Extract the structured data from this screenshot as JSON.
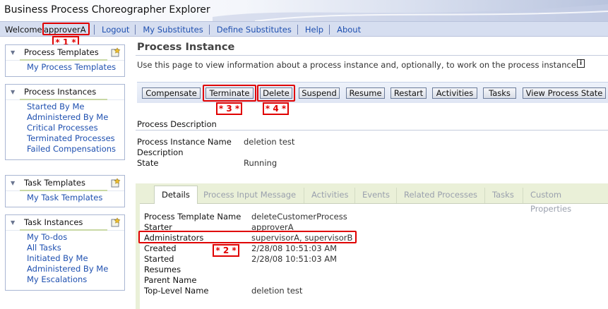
{
  "app": {
    "title": "Business Process Choreographer Explorer"
  },
  "nav": {
    "welcome": "Welcome",
    "user": "approverA",
    "links": [
      "Logout",
      "My Substitutes",
      "Define Substitutes",
      "Help",
      "About"
    ]
  },
  "sidebar": {
    "process_templates": {
      "title": "Process Templates",
      "items": [
        "My Process Templates"
      ]
    },
    "process_instances": {
      "title": "Process Instances",
      "items": [
        "Started By Me",
        "Administered By Me",
        "Critical Processes",
        "Terminated Processes",
        "Failed Compensations"
      ]
    },
    "task_templates": {
      "title": "Task Templates",
      "items": [
        "My Task Templates"
      ]
    },
    "task_instances": {
      "title": "Task Instances",
      "items": [
        "My To-dos",
        "All Tasks",
        "Initiated By Me",
        "Administered By Me",
        "My Escalations"
      ]
    }
  },
  "main": {
    "title": "Process Instance",
    "description": "Use this page to view information about a process instance and, optionally, to work on the process instance.",
    "info_icon": "i",
    "buttons": [
      "Compensate",
      "Terminate",
      "Delete",
      "Suspend",
      "Resume",
      "Restart",
      "Activities",
      "Tasks",
      "View Process State"
    ],
    "section": "Process Description",
    "fields": [
      {
        "label": "Process Instance Name",
        "value": "deletion test"
      },
      {
        "label": "Description",
        "value": ""
      },
      {
        "label": "State",
        "value": "Running"
      }
    ],
    "tabs": [
      "Details",
      "Process Input Message",
      "Activities",
      "Events",
      "Related Processes",
      "Tasks",
      "Custom Properties"
    ],
    "details": [
      {
        "label": "Process Template Name",
        "value": "deleteCustomerProcess"
      },
      {
        "label": "Starter",
        "value": "approverA"
      },
      {
        "label": "Administrators",
        "value": "supervisorA, supervisorB"
      },
      {
        "label": "Created",
        "value": "2/28/08 10:51:03 AM"
      },
      {
        "label": "Started",
        "value": "2/28/08 10:51:03 AM"
      },
      {
        "label": "Resumes",
        "value": ""
      },
      {
        "label": "Parent Name",
        "value": ""
      },
      {
        "label": "Top-Level Name",
        "value": "deletion test"
      }
    ]
  },
  "annotations": [
    "* 1 *",
    "* 2 *",
    "* 3 *",
    "* 4 *"
  ],
  "colors": {
    "link": "#1f50b0",
    "callout": "#e00000",
    "nav_bg": "#d6def0",
    "tab_panel": "#eaf0d8"
  }
}
